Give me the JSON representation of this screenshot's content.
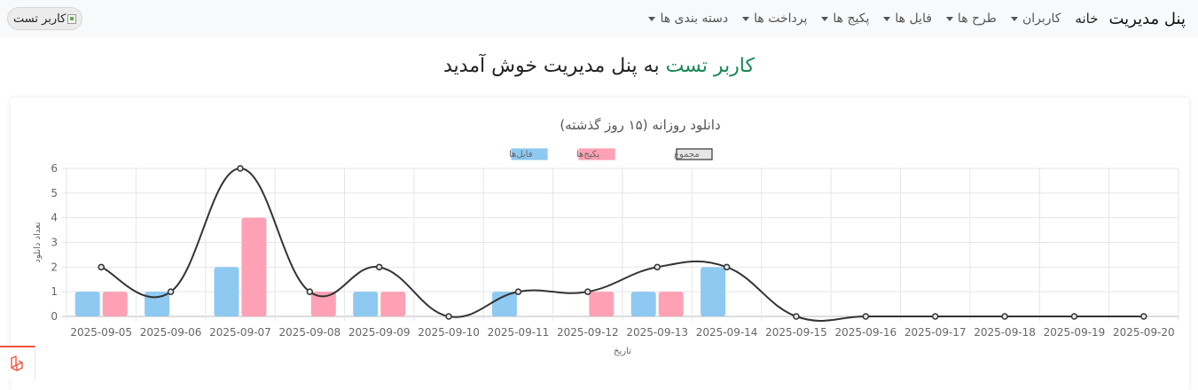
{
  "navbar": {
    "brand": "پنل مدیریت",
    "items": [
      {
        "label": "خانه",
        "dropdown": false,
        "active": true
      },
      {
        "label": "کاربران",
        "dropdown": true
      },
      {
        "label": "طرح ها",
        "dropdown": true
      },
      {
        "label": "فایل ها",
        "dropdown": true
      },
      {
        "label": "پکیج ها",
        "dropdown": true
      },
      {
        "label": "پرداخت ها",
        "dropdown": true
      },
      {
        "label": "دسته بندی ها",
        "dropdown": true
      }
    ],
    "user_label": "کاربر تست"
  },
  "welcome": {
    "username": "کاربر تست",
    "text": "به پنل مدیریت خوش آمدید"
  },
  "colors": {
    "files": "#8ec9f1",
    "packages": "#ffa1b4",
    "total_line": "#333333",
    "welcome_name": "#198754",
    "laravel": "#f05340"
  },
  "chart_data": {
    "type": "bar",
    "title": "دانلود روزانه (۱۵ روز گذشته)",
    "xlabel": "تاریخ",
    "ylabel": "تعداد دانلود",
    "ylim": [
      0,
      6
    ],
    "grid": true,
    "legend_position": "top",
    "categories": [
      "2025-09-05",
      "2025-09-06",
      "2025-09-07",
      "2025-09-08",
      "2025-09-09",
      "2025-09-10",
      "2025-09-11",
      "2025-09-12",
      "2025-09-13",
      "2025-09-14",
      "2025-09-15",
      "2025-09-16",
      "2025-09-17",
      "2025-09-18",
      "2025-09-19",
      "2025-09-20"
    ],
    "y_ticks": [
      0,
      1,
      2,
      3,
      4,
      5,
      6
    ],
    "series": [
      {
        "name": "فایل‌ها",
        "kind": "bar",
        "values": [
          1,
          1,
          2,
          0,
          1,
          0,
          1,
          0,
          1,
          2,
          0,
          0,
          0,
          0,
          0,
          0
        ]
      },
      {
        "name": "پکیج‌ها",
        "kind": "bar",
        "values": [
          1,
          0,
          4,
          1,
          1,
          0,
          0,
          1,
          1,
          0,
          0,
          0,
          0,
          0,
          0,
          0
        ]
      },
      {
        "name": "مجموع",
        "kind": "line",
        "values": [
          2,
          1,
          6,
          1,
          2,
          0,
          1,
          1,
          2,
          2,
          0,
          0,
          0,
          0,
          0,
          0
        ]
      }
    ]
  }
}
